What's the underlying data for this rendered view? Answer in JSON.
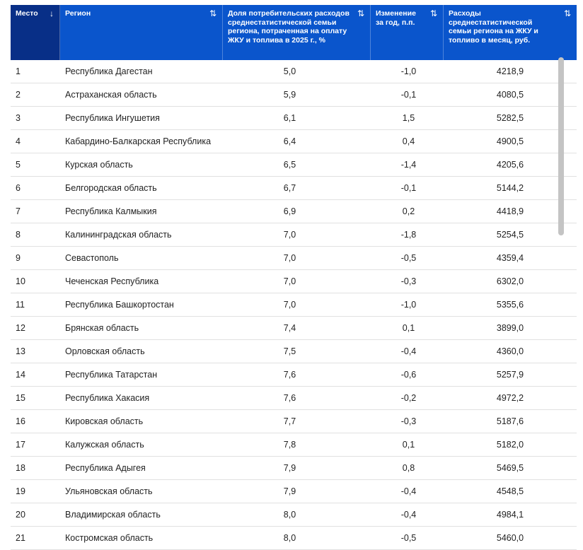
{
  "table": {
    "headers": [
      {
        "label": "Место",
        "sort_icon": "↓"
      },
      {
        "label": "Регион",
        "sort_icon": "⇅"
      },
      {
        "label": "Доля потребительских расходов среднестатистической семьи региона, потраченная на оплату ЖКУ и топлива в 2025 г., %",
        "sort_icon": "⇅"
      },
      {
        "label": "Изменение за год, п.п.",
        "sort_icon": "⇅"
      },
      {
        "label": "Расходы среднестатистической семьи региона на ЖКУ и топливо в месяц, руб.",
        "sort_icon": "⇅"
      }
    ],
    "rows": [
      [
        "1",
        "Республика Дагестан",
        "5,0",
        "-1,0",
        "4218,9"
      ],
      [
        "2",
        "Астраханская область",
        "5,9",
        "-0,1",
        "4080,5"
      ],
      [
        "3",
        "Республика Ингушетия",
        "6,1",
        "1,5",
        "5282,5"
      ],
      [
        "4",
        "Кабардино-Балкарская Республика",
        "6,4",
        "0,4",
        "4900,5"
      ],
      [
        "5",
        "Курская область",
        "6,5",
        "-1,4",
        "4205,6"
      ],
      [
        "6",
        "Белгородская область",
        "6,7",
        "-0,1",
        "5144,2"
      ],
      [
        "7",
        "Республика Калмыкия",
        "6,9",
        "0,2",
        "4418,9"
      ],
      [
        "8",
        "Калининградская область",
        "7,0",
        "-1,8",
        "5254,5"
      ],
      [
        "9",
        "Севастополь",
        "7,0",
        "-0,5",
        "4359,4"
      ],
      [
        "10",
        "Чеченская Республика",
        "7,0",
        "-0,3",
        "6302,0"
      ],
      [
        "11",
        "Республика Башкортостан",
        "7,0",
        "-1,0",
        "5355,6"
      ],
      [
        "12",
        "Брянская область",
        "7,4",
        "0,1",
        "3899,0"
      ],
      [
        "13",
        "Орловская область",
        "7,5",
        "-0,4",
        "4360,0"
      ],
      [
        "14",
        "Республика Татарстан",
        "7,6",
        "-0,6",
        "5257,9"
      ],
      [
        "15",
        "Республика Хакасия",
        "7,6",
        "-0,2",
        "4972,2"
      ],
      [
        "16",
        "Кировская область",
        "7,7",
        "-0,3",
        "5187,6"
      ],
      [
        "17",
        "Калужская область",
        "7,8",
        "0,1",
        "5182,0"
      ],
      [
        "18",
        "Республика Адыгея",
        "7,9",
        "0,8",
        "5469,5"
      ],
      [
        "19",
        "Ульяновская область",
        "7,9",
        "-0,4",
        "4548,5"
      ],
      [
        "20",
        "Владимирская область",
        "8,0",
        "-0,4",
        "4984,1"
      ],
      [
        "21",
        "Костромская область",
        "8,0",
        "-0,5",
        "5460,0"
      ]
    ]
  },
  "colors": {
    "header_bg": "#0a55cc",
    "header_active_bg": "#082f87",
    "row_border": "#e1e1e1",
    "scrollbar": "#c4c4c4"
  }
}
